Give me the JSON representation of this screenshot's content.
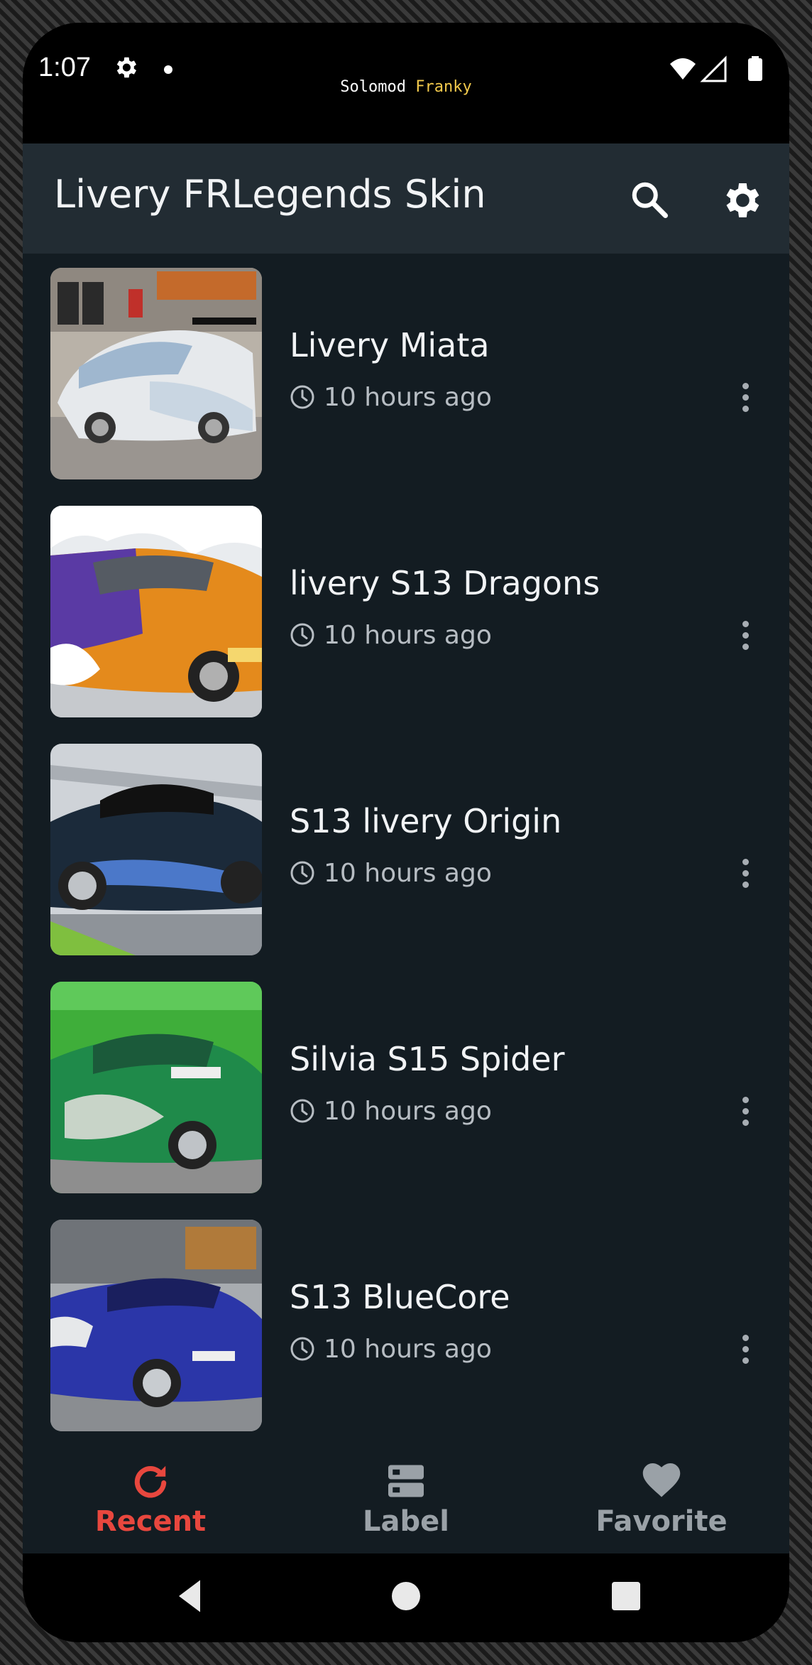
{
  "status_bar": {
    "time": "1:07",
    "banner_part1": "Solomod",
    "banner_part2": "Franky"
  },
  "toolbar": {
    "title": "Livery FRLegends Skin",
    "search_icon": "search-icon",
    "settings_icon": "gear-icon"
  },
  "items": [
    {
      "title": "Livery Miata",
      "time": "10 hours ago"
    },
    {
      "title": "livery S13 Dragons",
      "time": "10 hours ago"
    },
    {
      "title": "S13 livery Origin",
      "time": "10 hours ago"
    },
    {
      "title": "Silvia S15 Spider",
      "time": "10 hours ago"
    },
    {
      "title": "S13 BlueCore",
      "time": "10 hours ago"
    }
  ],
  "bottom_nav": {
    "recent": "Recent",
    "label": "Label",
    "favorite": "Favorite",
    "active": "Recent"
  },
  "colors": {
    "accent": "#e8473e",
    "toolbar_bg": "#222c33",
    "list_bg": "#131c22",
    "nav_inactive": "#9aa1a7"
  }
}
